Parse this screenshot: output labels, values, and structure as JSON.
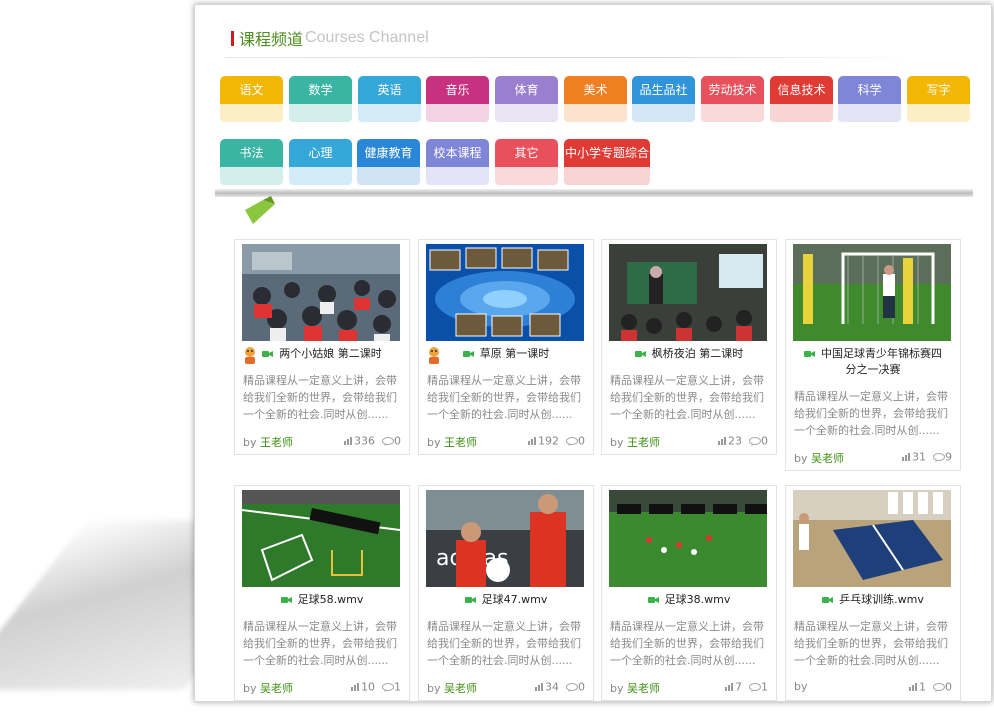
{
  "header": {
    "title_cn": "课程频道",
    "title_en": "Courses Channel"
  },
  "colors": {
    "accent_red": "#d11a1a",
    "teacher_green": "#3e8f12"
  },
  "categories": [
    {
      "label": "语文",
      "color": "#f2b705"
    },
    {
      "label": "数学",
      "color": "#3ab5a4"
    },
    {
      "label": "英语",
      "color": "#36a7d9"
    },
    {
      "label": "音乐",
      "color": "#c7317f"
    },
    {
      "label": "体育",
      "color": "#9a7fcf"
    },
    {
      "label": "美术",
      "color": "#f07f22"
    },
    {
      "label": "品生品社",
      "color": "#3193da"
    },
    {
      "label": "劳动技术",
      "color": "#e8505b"
    },
    {
      "label": "信息技术",
      "color": "#e03a34"
    },
    {
      "label": "科学",
      "color": "#7f86d8"
    },
    {
      "label": "写字",
      "color": "#f2b705"
    },
    {
      "label": "书法",
      "color": "#3ab5a4"
    },
    {
      "label": "心理",
      "color": "#36a7d9"
    },
    {
      "label": "健康教育",
      "color": "#2a86d6"
    },
    {
      "label": "校本课程",
      "color": "#7f86d8"
    },
    {
      "label": "其它",
      "color": "#e8505b"
    },
    {
      "label": "中小学专题综合",
      "color": "#e03a34"
    }
  ],
  "courses": [
    {
      "title": "两个小姑娘 第二课时",
      "desc": "精品课程从一定意义上讲，会带给我们全新的世界，会带给我们一个全新的社会.同时从创......",
      "by": "by",
      "teacher": "王老师",
      "views": "336",
      "comments": "0",
      "avatar": true,
      "icon": "video-icon",
      "thumb": "classroom"
    },
    {
      "title": "草原 第一课时",
      "desc": "精品课程从一定意义上讲，会带给我们全新的世界，会带给我们一个全新的社会.同时从创......",
      "by": "by",
      "teacher": "王老师",
      "views": "192",
      "comments": "0",
      "avatar": true,
      "icon": "video-icon",
      "thumb": "slide"
    },
    {
      "title": "枫桥夜泊 第二课时",
      "desc": "精品课程从一定意义上讲，会带给我们全新的世界，会带给我们一个全新的社会.同时从创......",
      "by": "by",
      "teacher": "王老师",
      "views": "23",
      "comments": "0",
      "avatar": false,
      "icon": "video-icon",
      "thumb": "lecture"
    },
    {
      "title": "中国足球青少年锦标赛四分之一决赛",
      "desc": "精品课程从一定意义上讲，会带给我们全新的世界，会带给我们一个全新的社会.同时从创......",
      "by": "by",
      "teacher": "吴老师",
      "views": "31",
      "comments": "9",
      "avatar": false,
      "icon": "video-icon",
      "thumb": "goal"
    },
    {
      "title": "足球58.wmv",
      "desc": "精品课程从一定意义上讲，会带给我们全新的世界，会带给我们一个全新的社会.同时从创......",
      "by": "by",
      "teacher": "吴老师",
      "views": "10",
      "comments": "1",
      "avatar": false,
      "icon": "video-icon",
      "thumb": "field"
    },
    {
      "title": "足球47.wmv",
      "desc": "精品课程从一定意义上讲，会带给我们全新的世界，会带给我们一个全新的社会.同时从创......",
      "by": "by",
      "teacher": "吴老师",
      "views": "34",
      "comments": "0",
      "avatar": false,
      "icon": "video-icon",
      "thumb": "kids"
    },
    {
      "title": "足球38.wmv",
      "desc": "精品课程从一定意义上讲，会带给我们全新的世界，会带给我们一个全新的社会.同时从创......",
      "by": "by",
      "teacher": "吴老师",
      "views": "7",
      "comments": "1",
      "avatar": false,
      "icon": "video-icon",
      "thumb": "pitch"
    },
    {
      "title": "乒乓球训练.wmv",
      "desc": "精品课程从一定意义上讲，会带给我们全新的世界，会带给我们一个全新的社会.同时从创......",
      "by": "by",
      "teacher": "",
      "views": "1",
      "comments": "0",
      "avatar": false,
      "icon": "video-icon",
      "thumb": "pingpong"
    }
  ]
}
